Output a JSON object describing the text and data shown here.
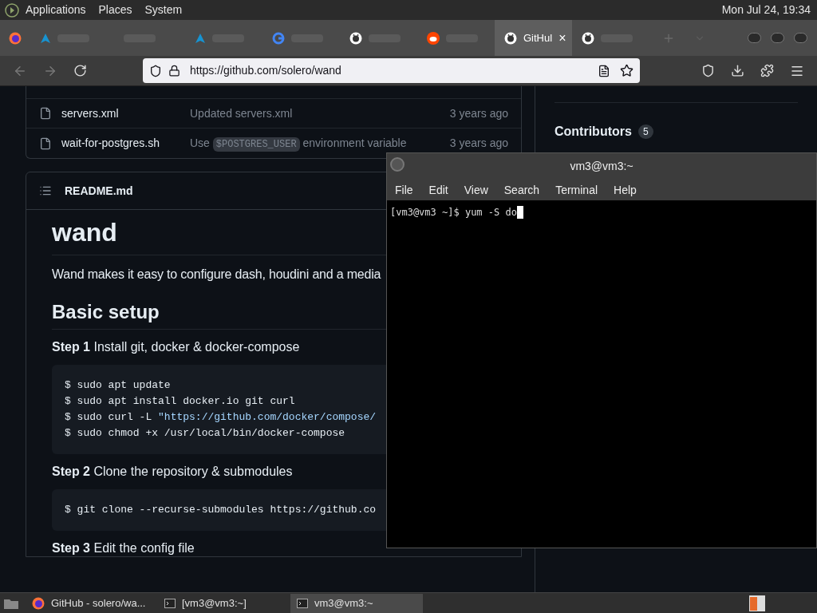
{
  "top_panel": {
    "menus": [
      "Applications",
      "Places",
      "System"
    ],
    "clock": "Mon Jul 24, 19:34"
  },
  "tabs": [
    {
      "kind": "arch",
      "selected": false
    },
    {
      "kind": "blank",
      "selected": false
    },
    {
      "kind": "arch",
      "selected": false
    },
    {
      "kind": "google",
      "selected": false
    },
    {
      "kind": "github",
      "selected": false
    },
    {
      "kind": "reddit",
      "selected": false
    },
    {
      "kind": "github",
      "selected": true,
      "title": "GitHul",
      "close": "×"
    },
    {
      "kind": "github",
      "selected": false
    }
  ],
  "address_bar": {
    "url": "https://github.com/solero/wand"
  },
  "files": [
    {
      "name": "servers.xml",
      "message": [
        {
          "kind": "text",
          "text": "Updated servers.xml"
        }
      ],
      "age": "3 years ago"
    },
    {
      "name": "wait-for-postgres.sh",
      "message": [
        {
          "kind": "text",
          "text": "Use "
        },
        {
          "kind": "code",
          "text": "$POSTGRES_USER"
        },
        {
          "kind": "text",
          "text": " environment variable"
        }
      ],
      "age": "3 years ago"
    }
  ],
  "sidebar": {
    "heading": "Contributors",
    "count": "5"
  },
  "readme": {
    "filename": "README.md",
    "title": "wand",
    "intro": "Wand makes it easy to configure dash, houdini and a media",
    "section": "Basic setup",
    "steps": [
      {
        "label": "Step 1",
        "text": " Install git, docker & docker-compose",
        "code": [
          [
            {
              "kind": "plain",
              "text": "$ sudo apt update"
            }
          ],
          [
            {
              "kind": "plain",
              "text": "$ sudo apt install docker.io git curl"
            }
          ],
          [
            {
              "kind": "plain",
              "text": "$ sudo curl -L "
            },
            {
              "kind": "string",
              "text": "\"https://github.com/docker/compose/"
            }
          ],
          [
            {
              "kind": "plain",
              "text": "$ sudo chmod +x /usr/local/bin/docker-compose"
            }
          ]
        ]
      },
      {
        "label": "Step 2",
        "text": " Clone the repository & submodules",
        "code": [
          [
            {
              "kind": "plain",
              "text": "$ git clone --recurse-submodules https://github.co"
            }
          ]
        ]
      },
      {
        "label": "Step 3",
        "text": " Edit the config file"
      }
    ]
  },
  "terminal": {
    "title": "vm3@vm3:~",
    "menus": [
      "File",
      "Edit",
      "View",
      "Search",
      "Terminal",
      "Help"
    ],
    "prompt": "[vm3@vm3 ~]$ yum -S do"
  },
  "taskbar": [
    {
      "kind": "browser",
      "label": "GitHub - solero/wa...",
      "selected": false
    },
    {
      "kind": "terminal",
      "label": "[vm3@vm3:~]",
      "selected": false
    },
    {
      "kind": "terminal",
      "label": "vm3@vm3:~",
      "selected": true
    }
  ]
}
